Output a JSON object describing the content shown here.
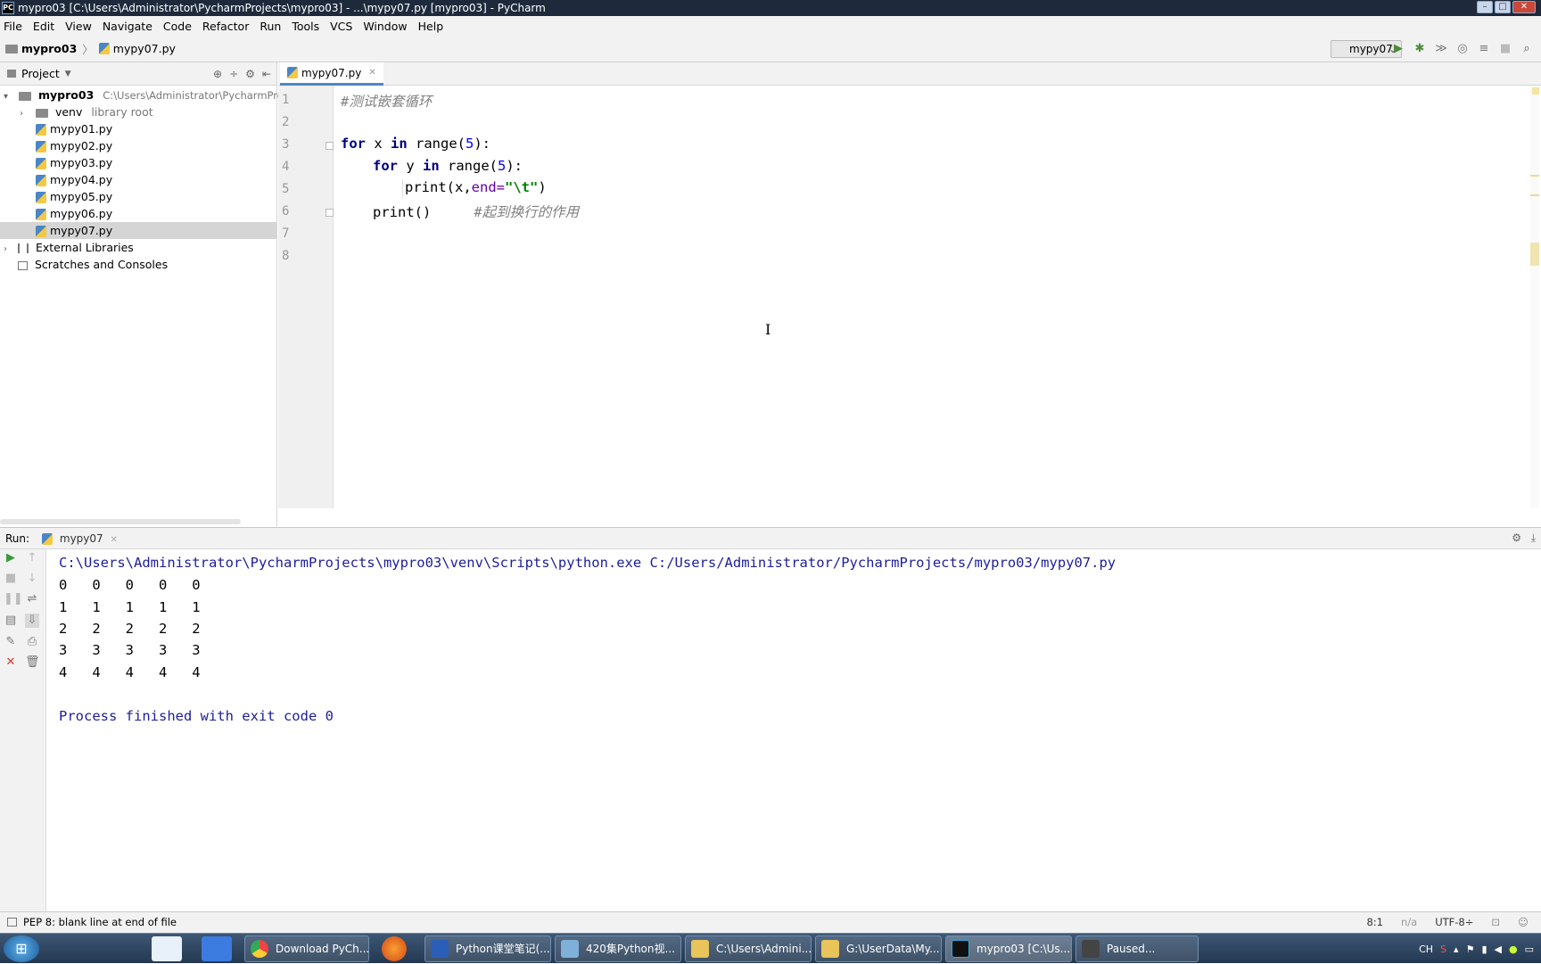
{
  "window": {
    "title": "mypro03 [C:\\Users\\Administrator\\PycharmProjects\\mypro03] - ...\\mypy07.py [mypro03] - PyCharm",
    "controls": [
      "–",
      "□",
      "✕"
    ]
  },
  "menu": [
    "File",
    "Edit",
    "View",
    "Navigate",
    "Code",
    "Refactor",
    "Run",
    "Tools",
    "VCS",
    "Window",
    "Help"
  ],
  "navbar": {
    "project": "mypro03",
    "file": "mypy07.py",
    "run_config": "mypy07"
  },
  "project_panel": {
    "title": "Project",
    "root": {
      "name": "mypro03",
      "path": "C:\\Users\\Administrator\\PycharmProjects\\m"
    },
    "venv": {
      "name": "venv",
      "hint": "library root"
    },
    "files": [
      "mypy01.py",
      "mypy02.py",
      "mypy03.py",
      "mypy04.py",
      "mypy05.py",
      "mypy06.py",
      "mypy07.py"
    ],
    "selected_file": "mypy07.py",
    "external": "External Libraries",
    "scratches": "Scratches and Consoles"
  },
  "editor": {
    "tab": "mypy07.py",
    "line_numbers": [
      "1",
      "2",
      "3",
      "4",
      "5",
      "6",
      "7",
      "8"
    ],
    "lines": {
      "l1_comment": "#测试嵌套循环",
      "l3_for": "for",
      "l3_mid": " x ",
      "l3_in": "in",
      "l3_range": " range(",
      "l3_num": "5",
      "l3_end": "):",
      "l4_for": "for",
      "l4_mid": " y ",
      "l4_in": "in",
      "l4_range": " range(",
      "l4_num": "5",
      "l4_end": "):",
      "l5_print": "print(x,",
      "l5_kwarg": "end=",
      "l5_str": "\"\\t\"",
      "l5_end": ")",
      "l6_print": "print()",
      "l6_comment": "#起到换行的作用"
    }
  },
  "run_panel": {
    "label": "Run:",
    "tab": "mypy07",
    "command": "C:\\Users\\Administrator\\PycharmProjects\\mypro03\\venv\\Scripts\\python.exe C:/Users/Administrator/PycharmProjects/mypro03/mypy07.py",
    "output_rows": [
      "0   0   0   0   0",
      "1   1   1   1   1",
      "2   2   2   2   2",
      "3   3   3   3   3",
      "4   4   4   4   4"
    ],
    "finished": "Process finished with exit code 0"
  },
  "status": {
    "message": "PEP 8: blank line at end of file",
    "position": "8:1",
    "na": "n/a",
    "encoding": "UTF-8÷"
  },
  "taskbar": {
    "items": [
      "Download PyCh...",
      "Python课堂笔记(...",
      "420集Python视...",
      "C:\\Users\\Admini...",
      "G:\\UserData\\My...",
      "mypro03 [C:\\Us...",
      "Paused..."
    ],
    "tray_lang": "CH"
  }
}
